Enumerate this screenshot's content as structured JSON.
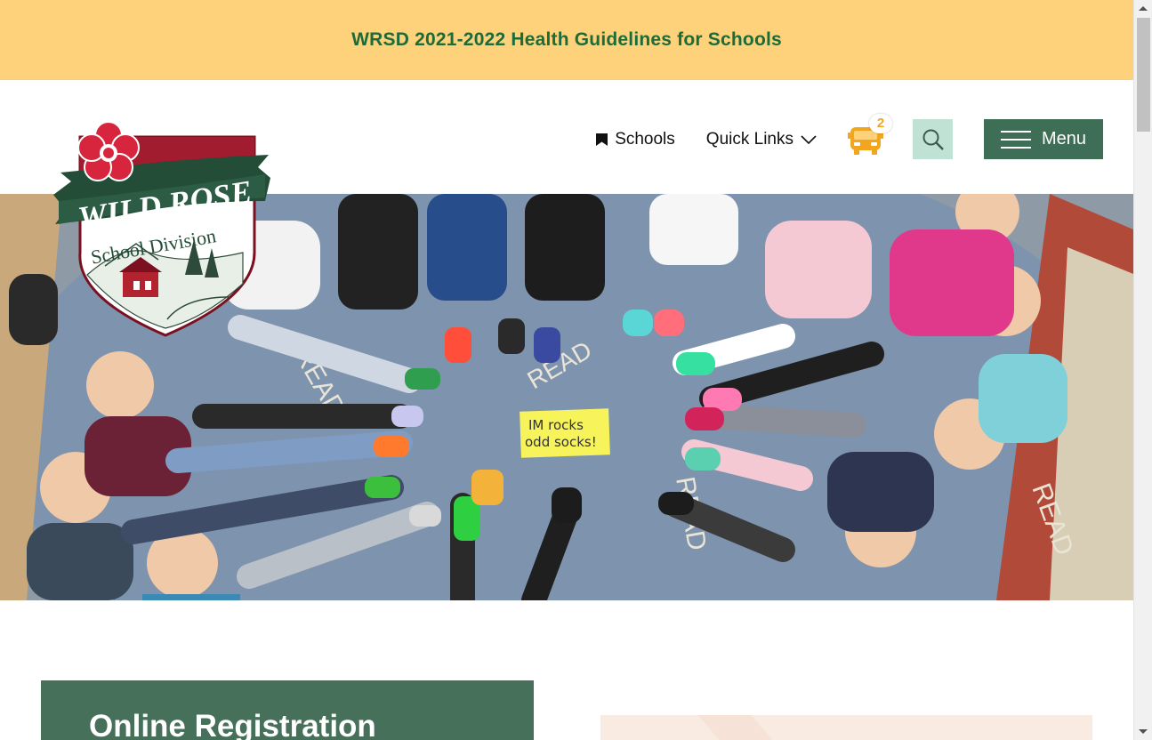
{
  "alert": {
    "text": "WRSD 2021-2022 Health Guidelines for Schools"
  },
  "logo": {
    "line1": "WILD ROSE",
    "line2": "School Division"
  },
  "nav": {
    "schools_label": "Schools",
    "quick_links_label": "Quick Links",
    "bus_badge_count": "2",
    "menu_label": "Menu"
  },
  "hero": {
    "sign_line1": "IM rocks",
    "sign_line2": "odd socks!"
  },
  "cards": {
    "registration_title": "Online Registration"
  },
  "colors": {
    "alert_bg": "#fdd27a",
    "alert_text": "#1d6b38",
    "brand_green": "#3f6e57",
    "search_bg": "#bfe2d4",
    "bus_orange": "#f2a51e"
  }
}
